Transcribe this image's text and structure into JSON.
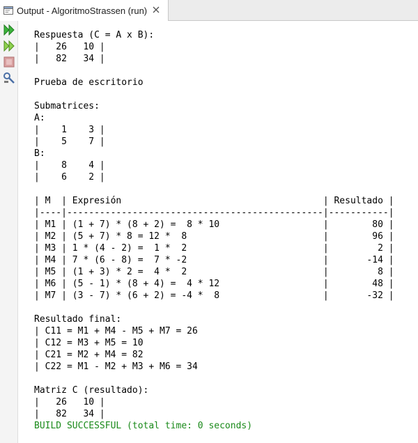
{
  "tab": {
    "title": "Output - AlgoritmoStrassen (run)"
  },
  "toolbar": {
    "buttons": [
      {
        "icon": "rerun-icon"
      },
      {
        "icon": "rerun-with-options-icon"
      },
      {
        "icon": "stop-icon"
      },
      {
        "icon": "settings-icon"
      }
    ]
  },
  "console": {
    "lines": [
      "Respuesta (C = A x B):",
      "|   26   10 |",
      "|   82   34 |",
      "",
      "Prueba de escritorio",
      "",
      "Submatrices:",
      "A:",
      "|    1    3 |",
      "|    5    7 |",
      "B:",
      "|    8    4 |",
      "|    6    2 |",
      "",
      "| M  | Expresión                                     | Resultado |",
      "|----|-----------------------------------------------|-----------|",
      "| M1 | (1 + 7) * (8 + 2) =  8 * 10                   |        80 |",
      "| M2 | (5 + 7) * 8 = 12 *  8                         |        96 |",
      "| M3 | 1 * (4 - 2) =  1 *  2                         |         2 |",
      "| M4 | 7 * (6 - 8) =  7 * -2                         |       -14 |",
      "| M5 | (1 + 3) * 2 =  4 *  2                         |         8 |",
      "| M6 | (5 - 1) * (8 + 4) =  4 * 12                   |        48 |",
      "| M7 | (3 - 7) * (6 + 2) = -4 *  8                   |       -32 |",
      "",
      "Resultado final:",
      "| C11 = M1 + M4 - M5 + M7 = 26",
      "| C12 = M3 + M5 = 10",
      "| C21 = M2 + M4 = 82",
      "| C22 = M1 - M2 + M3 + M6 = 34",
      "",
      "Matriz C (resultado):",
      "|   26   10 |",
      "|   82   34 |"
    ],
    "build_status": "BUILD SUCCESSFUL (total time: 0 seconds)"
  },
  "colors": {
    "success": "#1a8a1a",
    "run": "#3cb43c",
    "stop": "#d9a0a0"
  }
}
